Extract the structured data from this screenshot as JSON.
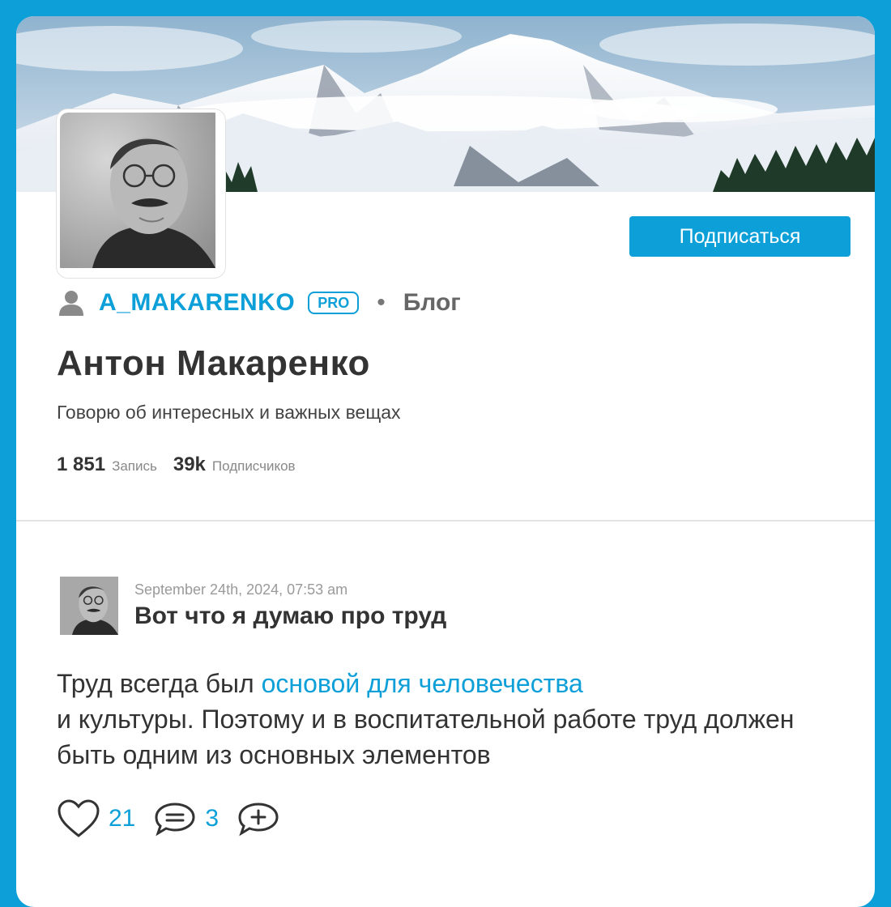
{
  "profile": {
    "username": "A_MAKARENKO",
    "badge": "PRO",
    "separator": "•",
    "type": "Блог",
    "full_name": "Антон Макаренко",
    "bio": "Говорю об интересных и важных вещах",
    "subscribe_label": "Подписаться",
    "stats": {
      "posts_count": "1 851",
      "posts_label": "Запись",
      "followers_count": "39k",
      "followers_label": "Подписчиков"
    }
  },
  "post": {
    "date": "September 24th, 2024, 07:53 am",
    "title": "Вот что я думаю про труд",
    "body_before_link": "Труд всегда был ",
    "body_link": "основой для человечества",
    "body_after_link": " и культуры. Поэтому и в воспитательной работе труд должен быть одним из основных элементов",
    "likes": "21",
    "comments": "3"
  },
  "icons": {
    "user": "user-icon",
    "like": "heart-icon",
    "comment": "comment-icon",
    "share": "add-icon"
  },
  "colors": {
    "accent": "#0d9fd8",
    "text": "#333333",
    "muted": "#888888"
  }
}
